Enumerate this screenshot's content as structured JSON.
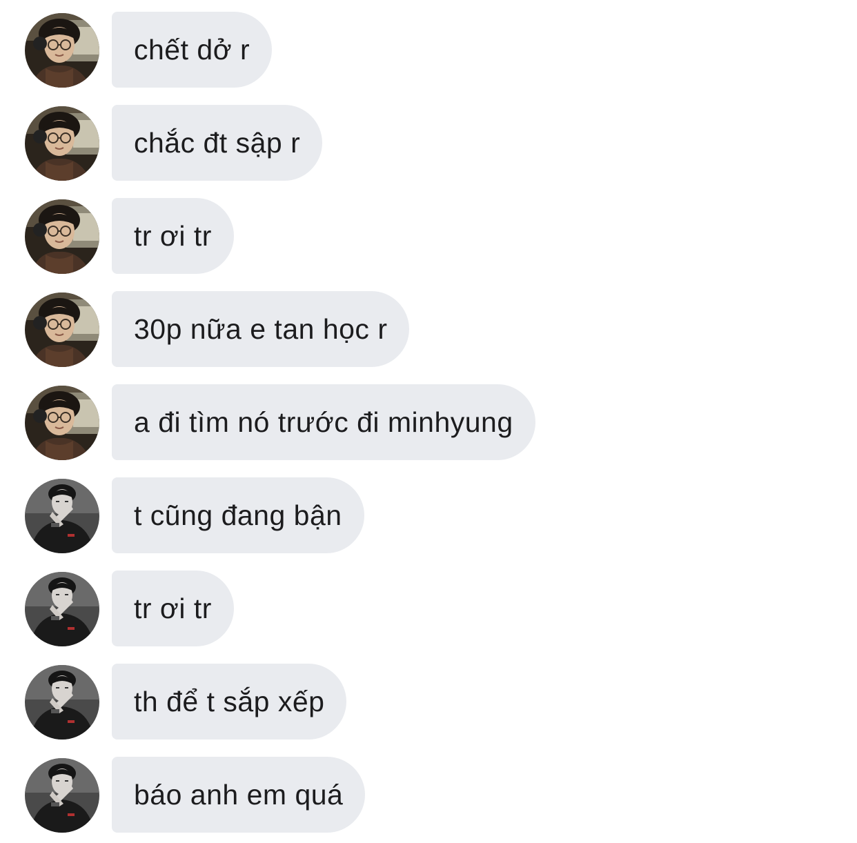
{
  "messages": [
    {
      "sender": "avatar-a",
      "text": "chết dở r"
    },
    {
      "sender": "avatar-a",
      "text": "chắc đt sập r"
    },
    {
      "sender": "avatar-a",
      "text": "tr ơi tr"
    },
    {
      "sender": "avatar-a",
      "text": "30p nữa e tan học r"
    },
    {
      "sender": "avatar-a",
      "text": "a đi tìm nó trước đi minhyung"
    },
    {
      "sender": "avatar-b",
      "text": "t cũng đang bận"
    },
    {
      "sender": "avatar-b",
      "text": "tr ơi tr"
    },
    {
      "sender": "avatar-b",
      "text": "th để t sắp xếp"
    },
    {
      "sender": "avatar-b",
      "text": "báo anh em quá"
    }
  ],
  "colors": {
    "background": "#ffffff",
    "bubble": "#e9ebef",
    "text": "#1c1c1e"
  }
}
